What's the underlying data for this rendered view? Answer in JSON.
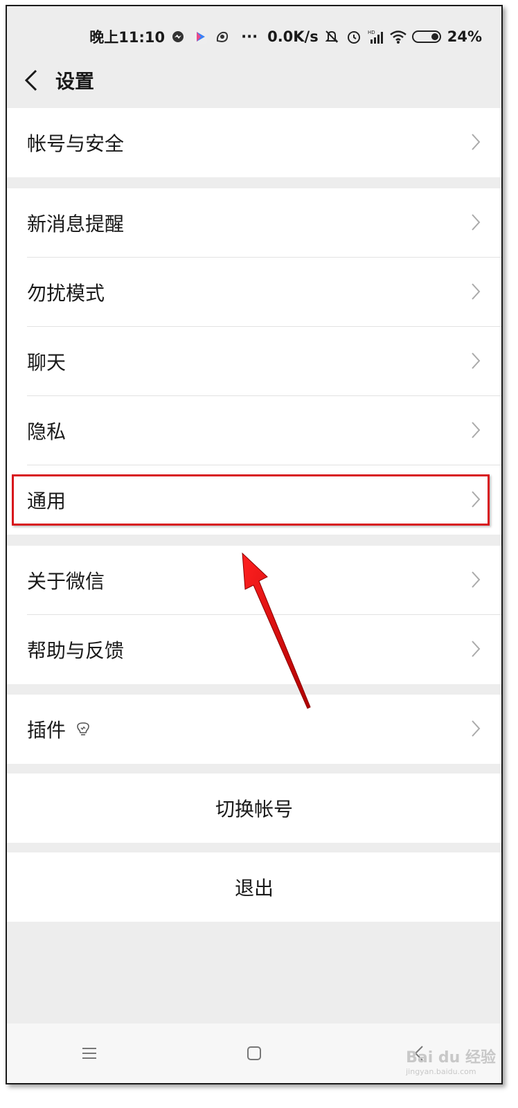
{
  "status_bar": {
    "time": "晚上11:10",
    "more": "···",
    "speed": "0.0K/s",
    "battery": "24%",
    "icons": [
      "messenger-icon",
      "play-store-icon",
      "uc-browser-icon",
      "mute-icon",
      "alarm-icon",
      "hd-signal-icon",
      "wifi-icon",
      "battery-icon"
    ]
  },
  "header": {
    "title": "设置"
  },
  "groups": [
    {
      "items": [
        {
          "label": "帐号与安全"
        }
      ]
    },
    {
      "items": [
        {
          "label": "新消息提醒"
        },
        {
          "label": "勿扰模式"
        },
        {
          "label": "聊天"
        },
        {
          "label": "隐私"
        },
        {
          "label": "通用"
        }
      ]
    },
    {
      "items": [
        {
          "label": "关于微信"
        },
        {
          "label": "帮助与反馈"
        }
      ]
    },
    {
      "items": [
        {
          "label": "插件",
          "icon": "lightbulb-icon"
        }
      ]
    }
  ],
  "actions": {
    "switch_account": "切换帐号",
    "logout": "退出"
  },
  "annotation": {
    "highlight_color": "#d8141b",
    "target": "通用"
  },
  "watermark": {
    "text": "Bai du 经验",
    "sub": "jingyan.baidu.com"
  }
}
